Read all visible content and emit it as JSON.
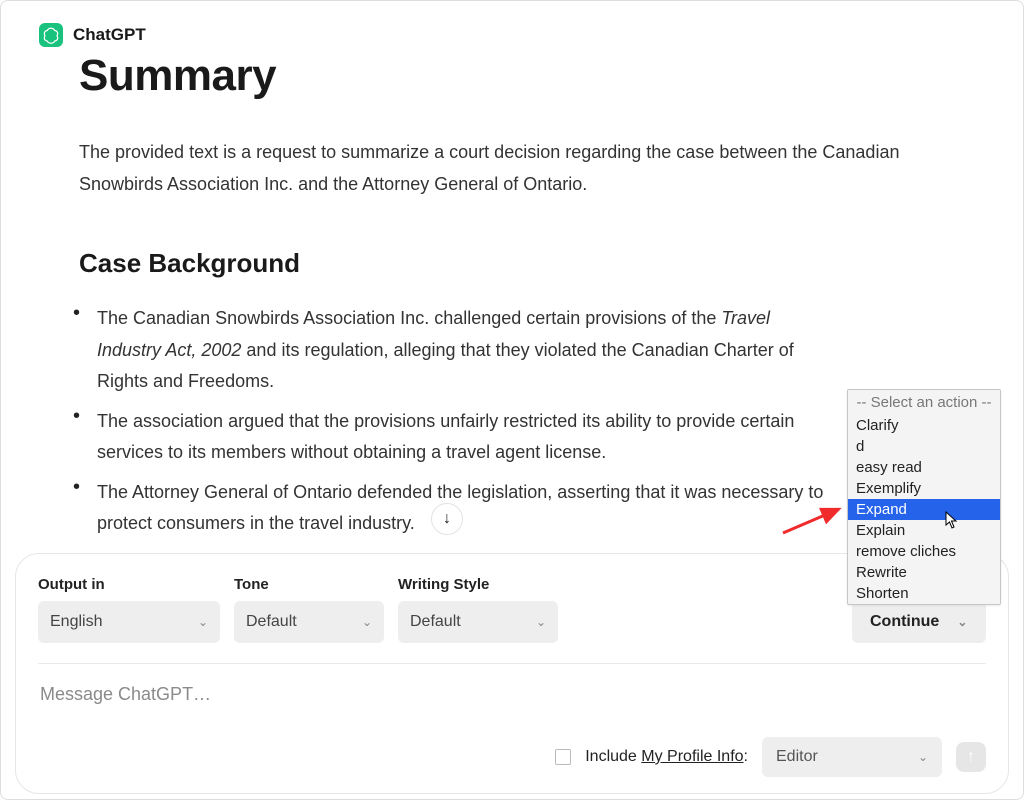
{
  "header": {
    "app_name": "ChatGPT",
    "page_title": "Summary"
  },
  "content": {
    "intro": "The provided text is a request to summarize a court decision regarding the case between the Canadian Snowbirds Association Inc. and the Attorney General of Ontario.",
    "section_heading": "Case Background",
    "bullets": {
      "b1_prefix": "The Canadian Snowbirds Association Inc. challenged certain provisions of the ",
      "b1_italic": "Travel Industry Act, 2002",
      "b1_suffix": " and its regulation, alleging that they violated the Canadian Charter of Rights and Freedoms.",
      "b2": "The association argued that the provisions unfairly restricted its ability to provide certain services to its members without obtaining a travel agent license.",
      "b3": "The Attorney General of Ontario defended the legislation, asserting that it was necessary to protect consumers in the travel industry."
    }
  },
  "controls": {
    "output_label": "Output in",
    "output_value": "English",
    "tone_label": "Tone",
    "tone_value": "Default",
    "style_label": "Writing Style",
    "style_value": "Default",
    "continue_label": "Continue"
  },
  "message": {
    "placeholder": "Message ChatGPT…"
  },
  "footer": {
    "include_prefix": "Include ",
    "include_underline": "My Profile Info",
    "include_suffix": ":",
    "editor_value": "Editor"
  },
  "dropdown": {
    "header": "-- Select an action --",
    "items": [
      "Clarify",
      "d",
      "easy read",
      "Exemplify",
      "Expand",
      "Explain",
      "remove cliches",
      "Rewrite",
      "Shorten"
    ],
    "highlighted": "Expand"
  }
}
